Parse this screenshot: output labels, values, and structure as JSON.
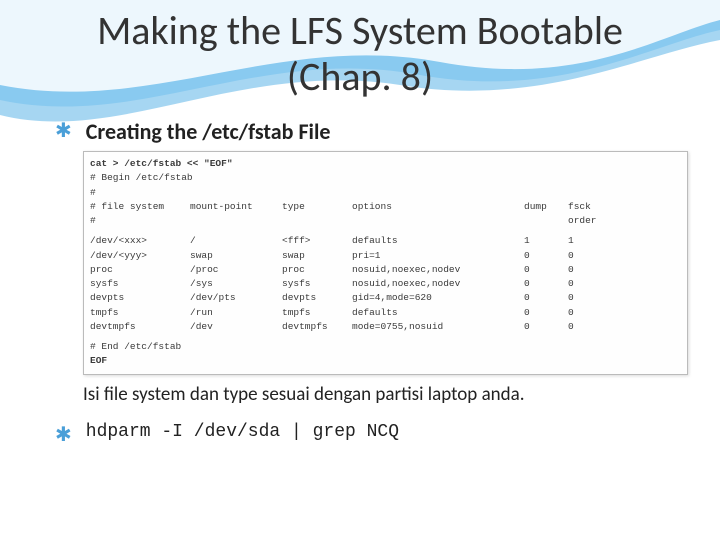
{
  "title_line1": "Making the LFS System Bootable",
  "title_line2": "(Chap. 8)",
  "bullet1": "Creating the /etc/fstab File",
  "code": {
    "cat_line": "cat > /etc/fstab << \"EOF\"",
    "begin": "# Begin /etc/fstab",
    "hash": "#",
    "hdr": {
      "c1": "# file system",
      "c2": "mount-point",
      "c3": "type",
      "c4": "options",
      "c5": "dump",
      "c6": "fsck"
    },
    "hdr2_c6": "order",
    "rows": [
      {
        "c1": "/dev/<xxx>",
        "c2": "/",
        "c3": "<fff>",
        "c4": "defaults",
        "c5": "1",
        "c6": "1"
      },
      {
        "c1": "/dev/<yyy>",
        "c2": "swap",
        "c3": "swap",
        "c4": "pri=1",
        "c5": "0",
        "c6": "0"
      },
      {
        "c1": "proc",
        "c2": "/proc",
        "c3": "proc",
        "c4": "nosuid,noexec,nodev",
        "c5": "0",
        "c6": "0"
      },
      {
        "c1": "sysfs",
        "c2": "/sys",
        "c3": "sysfs",
        "c4": "nosuid,noexec,nodev",
        "c5": "0",
        "c6": "0"
      },
      {
        "c1": "devpts",
        "c2": "/dev/pts",
        "c3": "devpts",
        "c4": "gid=4,mode=620",
        "c5": "0",
        "c6": "0"
      },
      {
        "c1": "tmpfs",
        "c2": "/run",
        "c3": "tmpfs",
        "c4": "defaults",
        "c5": "0",
        "c6": "0"
      },
      {
        "c1": "devtmpfs",
        "c2": "/dev",
        "c3": "devtmpfs",
        "c4": "mode=0755,nosuid",
        "c5": "0",
        "c6": "0"
      }
    ],
    "end": "# End /etc/fstab",
    "eof": "EOF"
  },
  "note": "Isi file system dan type sesuai dengan partisi laptop anda.",
  "bullet2": "hdparm -I /dev/sda | grep NCQ"
}
